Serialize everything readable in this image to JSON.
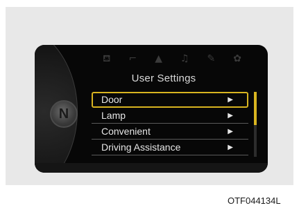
{
  "display": {
    "gear_indicator": "N",
    "title": "User Settings",
    "top_icons": [
      {
        "name": "seat-icon",
        "glyph": "⛾"
      },
      {
        "name": "door-icon",
        "glyph": "⌐"
      },
      {
        "name": "car-icon",
        "glyph": "▲"
      },
      {
        "name": "music-icon",
        "glyph": "♫"
      },
      {
        "name": "wrench-icon",
        "glyph": "✎"
      },
      {
        "name": "gear-icon",
        "glyph": "✿"
      }
    ],
    "menu": {
      "items": [
        {
          "label": "Door",
          "arrow": "▶",
          "selected": true
        },
        {
          "label": "Lamp",
          "arrow": "▶",
          "selected": false
        },
        {
          "label": "Convenient",
          "arrow": "▶",
          "selected": false
        },
        {
          "label": "Driving Assistance",
          "arrow": "▶",
          "selected": false
        }
      ]
    },
    "scroll_position": 0.5,
    "colors": {
      "selection": "#d8b420",
      "text": "#e6e6e6",
      "background": "#070707"
    }
  },
  "caption": "OTF044134L"
}
